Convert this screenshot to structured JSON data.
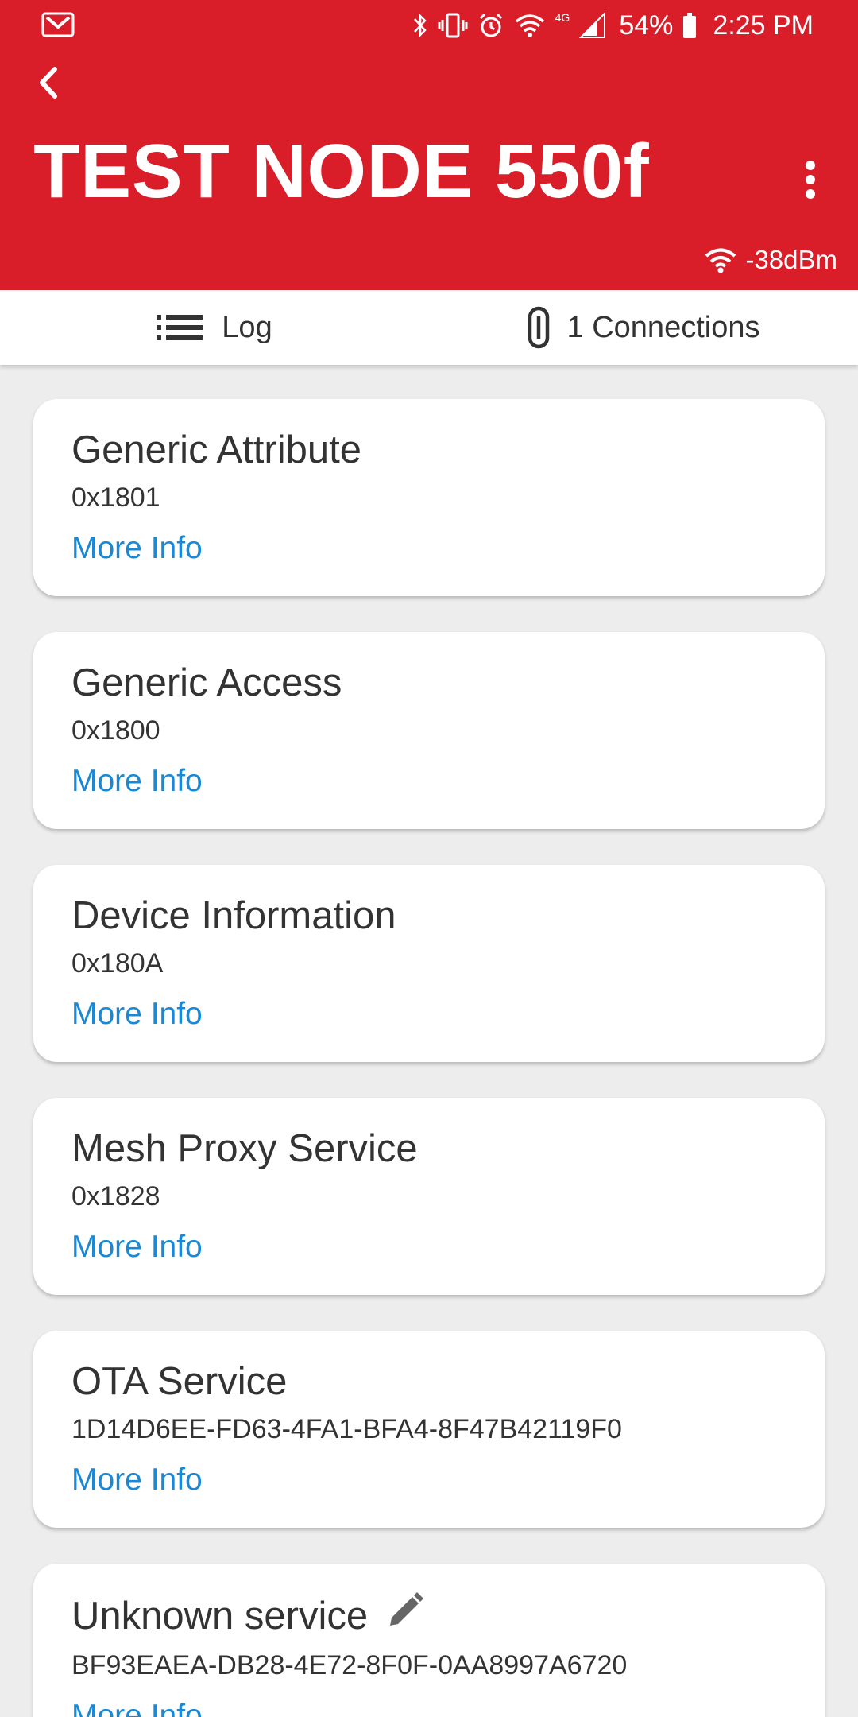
{
  "status_bar": {
    "battery_percent": "54%",
    "time": "2:25 PM",
    "network_badge": "4G",
    "icons": [
      "gmail-icon",
      "bluetooth-icon",
      "vibrate-icon",
      "alarm-icon",
      "wifi-icon",
      "signal-icon",
      "battery-icon"
    ]
  },
  "header": {
    "title": "TEST NODE 550f",
    "rssi": "-38dBm",
    "color": "#d91e2a"
  },
  "tabs": [
    {
      "label": "Log",
      "icon": "list-icon"
    },
    {
      "label": "1 Connections",
      "icon": "link-icon"
    }
  ],
  "services": [
    {
      "name": "Generic Attribute",
      "uuid": "0x1801",
      "link": "More Info"
    },
    {
      "name": "Generic Access",
      "uuid": "0x1800",
      "link": "More Info"
    },
    {
      "name": "Device Information",
      "uuid": "0x180A",
      "link": "More Info"
    },
    {
      "name": "Mesh Proxy Service",
      "uuid": "0x1828",
      "link": "More Info"
    },
    {
      "name": "OTA Service",
      "uuid": "1D14D6EE-FD63-4FA1-BFA4-8F47B42119F0",
      "link": "More Info"
    },
    {
      "name": "Unknown service",
      "uuid": "BF93EAEA-DB28-4E72-8F0F-0AA8997A6720",
      "link": "More Info",
      "editable": true
    }
  ],
  "colors": {
    "accent": "#d91e2a",
    "link": "#1a88d4"
  }
}
